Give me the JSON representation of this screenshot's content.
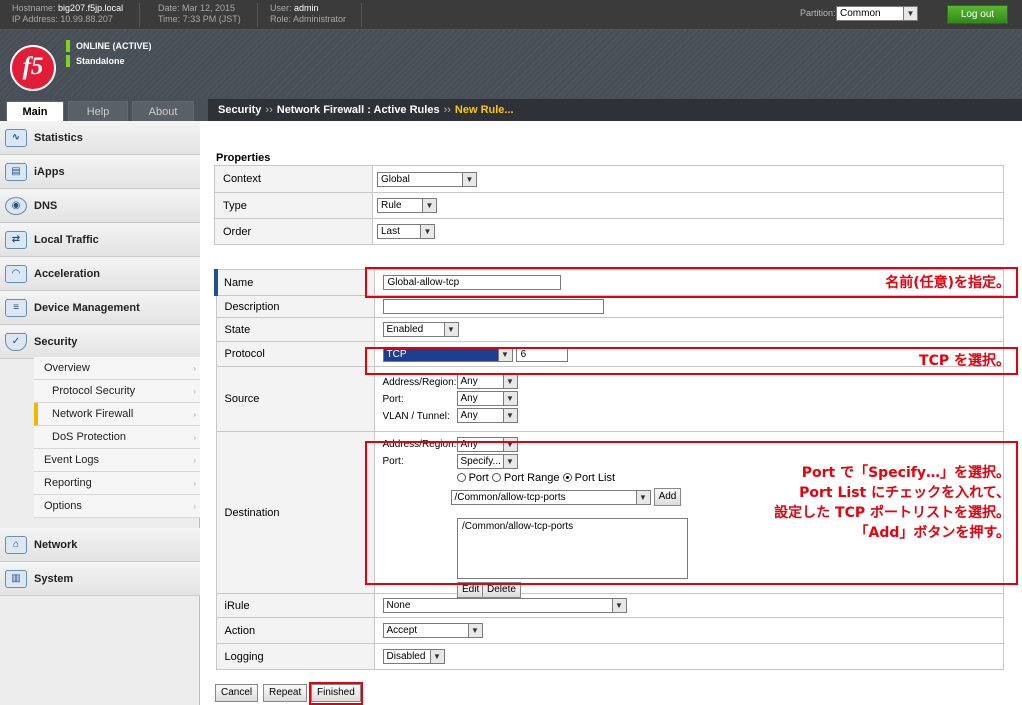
{
  "header": {
    "hostname_label": "Hostname:",
    "hostname": "big207.f5jp.local",
    "ip_label": "IP Address:",
    "ip": "10.99.88.207",
    "date_label": "Date:",
    "date": "Mar 12, 2015",
    "time_label": "Time:",
    "time": "7:33 PM (JST)",
    "user_label": "User:",
    "user": "admin",
    "role_label": "Role:",
    "role": "Administrator",
    "partition_label": "Partition:",
    "partition": "Common",
    "logout": "Log out"
  },
  "status": {
    "logo": "f5",
    "online": "ONLINE (ACTIVE)",
    "mode": "Standalone"
  },
  "tabs": [
    "Main",
    "Help",
    "About"
  ],
  "breadcrumb": {
    "a": "Security",
    "sep": "››",
    "b": "Network Firewall : Active Rules",
    "c": "New Rule..."
  },
  "sidebar": {
    "items": [
      "Statistics",
      "iApps",
      "DNS",
      "Local Traffic",
      "Acceleration",
      "Device Management",
      "Security",
      "Network",
      "System"
    ],
    "security_sub": [
      "Overview",
      "Protocol Security",
      "Network Firewall",
      "DoS Protection",
      "Event Logs",
      "Reporting",
      "Options"
    ]
  },
  "properties": {
    "title": "Properties",
    "context_label": "Context",
    "context": "Global",
    "type_label": "Type",
    "type": "Rule",
    "order_label": "Order",
    "order": "Last"
  },
  "rule": {
    "name_label": "Name",
    "name": "Global-allow-tcp",
    "description_label": "Description",
    "description": "",
    "state_label": "State",
    "state": "Enabled",
    "protocol_label": "Protocol",
    "protocol": "TCP",
    "protocol_num": "6",
    "source_label": "Source",
    "addr_region_label": "Address/Region:",
    "port_label": "Port:",
    "vlan_label": "VLAN / Tunnel:",
    "any": "Any",
    "destination_label": "Destination",
    "dest_port": "Specify...",
    "radio_port": "Port",
    "radio_range": "Port Range",
    "radio_list": "Port List",
    "port_list_select": "/Common/allow-tcp-ports",
    "add_button": "Add",
    "port_list_item": "/Common/allow-tcp-ports",
    "edit_button": "Edit",
    "delete_button": "Delete",
    "irule_label": "iRule",
    "irule": "None",
    "action_label": "Action",
    "action": "Accept",
    "logging_label": "Logging",
    "logging": "Disabled"
  },
  "buttons": {
    "cancel": "Cancel",
    "repeat": "Repeat",
    "finished": "Finished"
  },
  "annotations": {
    "name": "名前(任意)を指定。",
    "protocol": "TCP を選択。",
    "dest_line1": "Port で「Specify…」を選択。",
    "dest_line2": "Port List にチェックを入れて、",
    "dest_line3": "設定した TCP ポートリストを選択。",
    "dest_line4": "「Add」ボタンを押す。"
  },
  "colors": {
    "annotation_red": "#e2000f",
    "logout_green": "#3c9a1e",
    "active_yellow": "#f2b700",
    "selected_blue": "#1e3f8f"
  }
}
